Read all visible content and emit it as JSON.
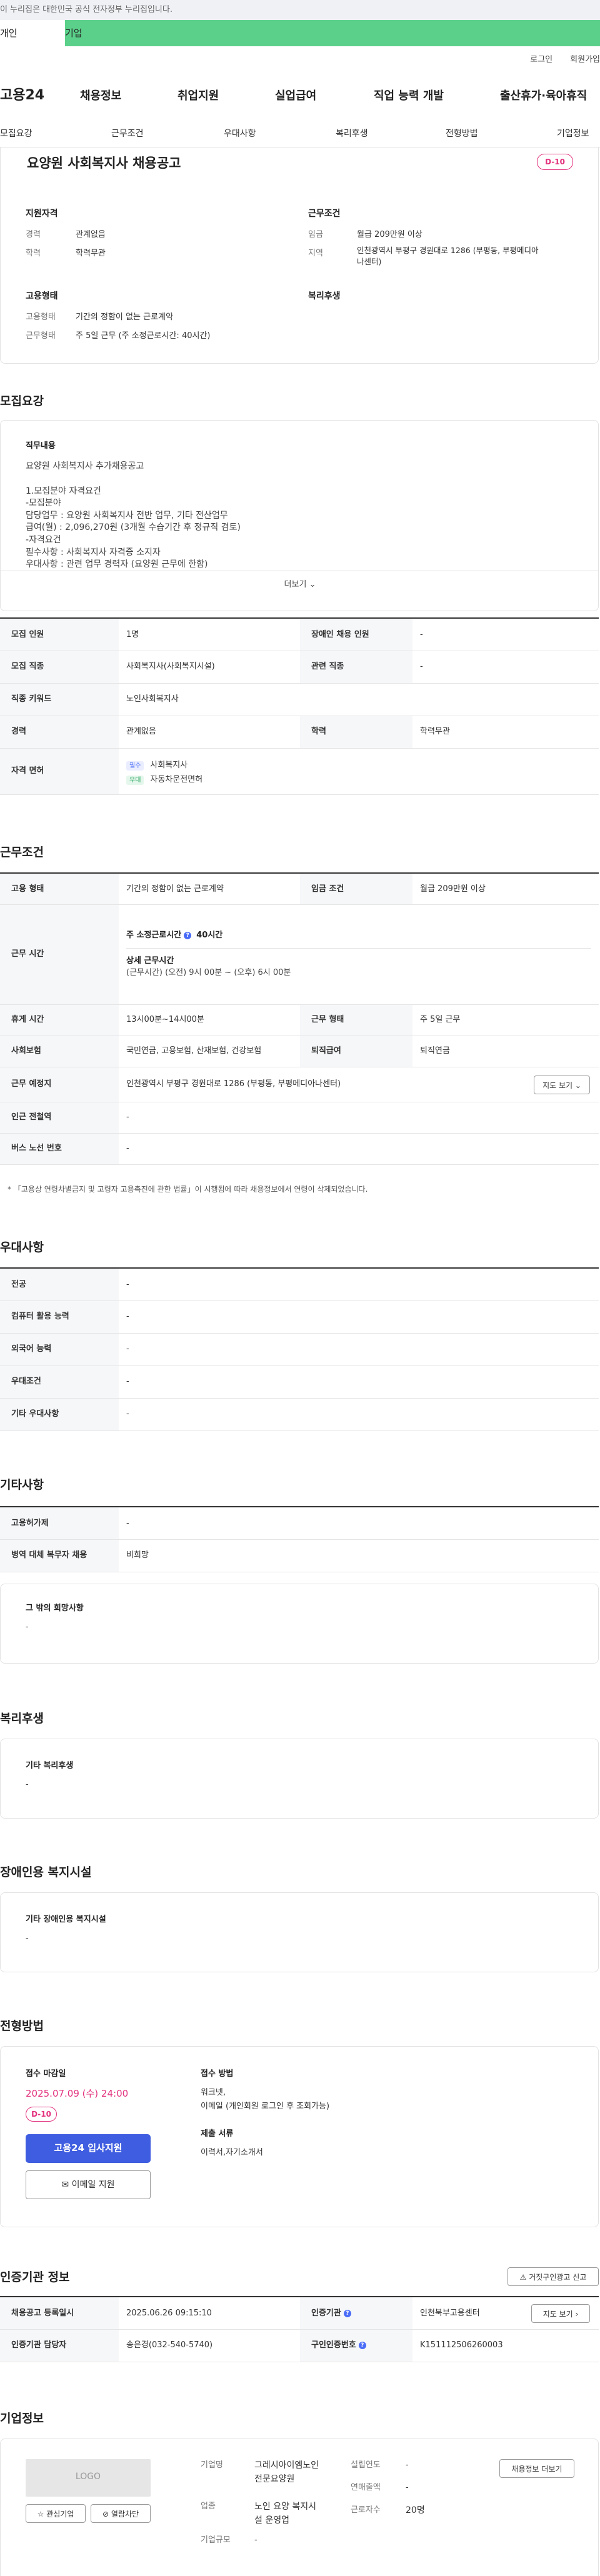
{
  "gov_banner": "이 누리집은 대한민국 공식 전자정부 누리집입니다.",
  "member_tabs": [
    "개인",
    "기업"
  ],
  "util_links": [
    "로그인",
    "회원가입"
  ],
  "logo": "고용24",
  "gnb": [
    "채용정보",
    "취업지원",
    "실업급여",
    "직업 능력 개발",
    "출산휴가·육아휴직"
  ],
  "anchor_tabs": [
    "모집요강",
    "근무조건",
    "우대사항",
    "복리후생",
    "전형방법",
    "기업정보"
  ],
  "summary": {
    "title": "요양원 사회복지사 채용공고",
    "dday": "D-10",
    "qual_title": "지원자격",
    "career_k": "경력",
    "career_v": "관계없음",
    "edu_k": "학력",
    "edu_v": "학력무관",
    "cond_title": "근무조건",
    "wage_k": "임금",
    "wage_v": "월급 209만원 이상",
    "loc_k": "지역",
    "loc_v1": "인천광역시 부평구 경원대로 1286 (부평동, 부평메디아",
    "loc_v2": "나센터)",
    "emp_title": "고용형태",
    "type_k": "고용형태",
    "type_v": "기간의 정함이 없는 근로계약",
    "form_k": "근무형태",
    "form_v": "주 5일 근무 (주 소정근로시간: 40시간)",
    "welfare_title": "복리후생"
  },
  "recruit": {
    "title": "모집요강",
    "desc_title": "직무내용",
    "desc_lines": [
      "요양원 사회복지사 추가채용공고",
      "",
      "1.모집분야 자격요건",
      "-모집분야",
      "담당업무 : 요양원 사회복지사 전반 업무, 기타 전산업무",
      "급여(월) : 2,096,270원 (3개월 수습기간 후 정규직 검토)",
      "-자격요건",
      "필수사항 : 사회복지사 자격증 소지자",
      "우대사항 : 관련 업무 경력자 (요양원 근무에 한함)"
    ],
    "more": "더보기",
    "rows": {
      "r1k": "모집 인원",
      "r1v": "1명",
      "r1k2": "장애인 채용 인원",
      "r1v2": "-",
      "r2k": "모집 직종",
      "r2v": "사회복지사(사회복지시설)",
      "r2k2": "관련 직종",
      "r2v2": "-",
      "r3k": "직종 키워드",
      "r3v": "노인사회복지사",
      "r4k": "경력",
      "r4v": "관계없음",
      "r4k2": "학력",
      "r4v2": "학력무관",
      "r5k": "자격 면허",
      "tag_must": "필수",
      "lic1": "사회복지사",
      "tag_pref": "우대",
      "lic2": "자동차운전면허"
    }
  },
  "work": {
    "title": "근무조건",
    "type_k": "고용 형태",
    "type_v": "기간의 정함이 없는 근로계약",
    "wage_k": "임금 조건",
    "wage_v": "월급 209만원 이상",
    "time_k": "근무 시간",
    "hours_label": "주 소정근로시간",
    "hours_v": "40시간",
    "detail_label": "상세 근무시간",
    "detail_v": "(근무시간) (오전) 9시 00분 ~ (오후) 6시 00분",
    "break_k": "휴게 시간",
    "break_v": "13시00분~14시00분",
    "form_k": "근무 형태",
    "form_v": "주 5일 근무",
    "ins_k": "사회보험",
    "ins_v": "국민연금, 고용보험, 산재보험, 건강보험",
    "ret_k": "퇴직급여",
    "ret_v": "퇴직연금",
    "place_k": "근무 예정지",
    "place_v": "인천광역시 부평구 경원대로 1286 (부평동, 부평메디아나센터)",
    "map_btn": "지도 보기",
    "subway_k": "인근 전철역",
    "subway_v": "-",
    "bus_k": "버스 노선 번호",
    "bus_v": "-",
    "note": "* 「고용상 연령차별금지 및 고령자 고용촉진에 관한 법률」이 시행됨에 따라 채용정보에서 연령이 삭제되었습니다."
  },
  "pref": {
    "title": "우대사항",
    "rows": [
      {
        "k": "전공",
        "v": "-"
      },
      {
        "k": "컴퓨터 활용 능력",
        "v": "-"
      },
      {
        "k": "외국어 능력",
        "v": "-"
      },
      {
        "k": "우대조건",
        "v": "-"
      },
      {
        "k": "기타 우대사항",
        "v": "-"
      }
    ]
  },
  "etc": {
    "title": "기타사항",
    "emp_k": "고용허가제",
    "emp_v": "-",
    "mil_k": "병역 대체 복무자 채용",
    "mil_v": "비희망",
    "other_title": "그 밖의 희망사항",
    "other_v": "-"
  },
  "welfare": {
    "title": "복리후생",
    "sub": "기타 복리후생",
    "v": "-"
  },
  "disabled": {
    "title": "장애인용 복지시설",
    "sub": "기타 장애인용 복지시설",
    "v": "-"
  },
  "selection": {
    "title": "전형방법",
    "deadline_label": "접수 마감일",
    "deadline": "2025.07.09 (수) 24:00",
    "dday": "D-10",
    "apply_btn": "고용24 입사지원",
    "email_btn": "이메일 지원",
    "method_label": "접수 방법",
    "method_v1": "워크넷,",
    "method_v2": "이메일 (개인회원 로그인 후 조회가능)",
    "docs_label": "제출 서류",
    "docs_v": "이력서,자기소개서"
  },
  "cert": {
    "title": "인증기관 정보",
    "report_btn": "거짓구인광고 신고",
    "reg_k": "채용공고 등록일시",
    "reg_v": "2025.06.26 09:15:10",
    "org_k": "인증기관",
    "org_v": "인천북부고용센터",
    "map_btn": "지도 보기",
    "mgr_k": "인증기관 담당자",
    "mgr_v": "송은경(032-540-5740)",
    "id_k": "구인인증번호",
    "id_v": "K151112506260003"
  },
  "company": {
    "title": "기업정보",
    "logo": "LOGO",
    "fav_btn": "관심기업",
    "block_btn": "열람차단",
    "name_k": "기업명",
    "name_v1": "그레시아이엠노인",
    "name_v2": "전문요양원",
    "year_k": "설립연도",
    "year_v": "-",
    "sales_k": "연매출액",
    "sales_v": "-",
    "ind_k": "업종",
    "ind_v1": "노인 요양 복지시",
    "ind_v2": "설 운영업",
    "staff_k": "근로자수",
    "staff_v": "20명",
    "size_k": "기업규모",
    "size_v": "-",
    "jobs_btn": "채용정보 더보기"
  }
}
